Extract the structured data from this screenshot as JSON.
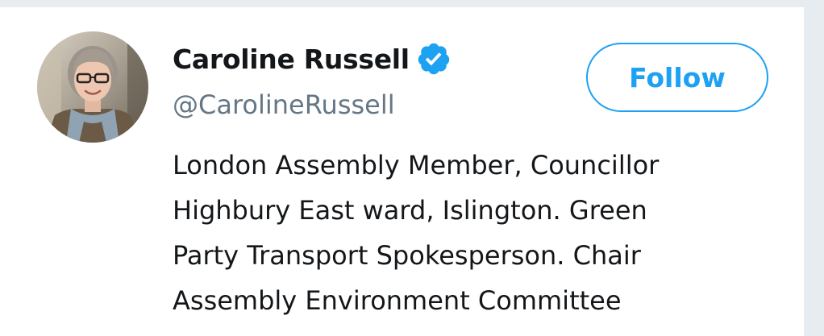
{
  "profile": {
    "name": "Caroline Russell",
    "handle": "@CarolineRussell",
    "verified": true,
    "verified_icon": "verified-badge-icon",
    "avatar": "profile-photo",
    "bio_lines": [
      "London Assembly Member, Councillor",
      "Highbury East ward, Islington. Green",
      "Party Transport Spokesperson. Chair",
      "Assembly Environment Committee"
    ]
  },
  "actions": {
    "follow_label": "Follow"
  },
  "colors": {
    "accent": "#1da1f2",
    "text_primary": "#14171a",
    "text_secondary": "#657786",
    "background": "#e6ecf0"
  }
}
